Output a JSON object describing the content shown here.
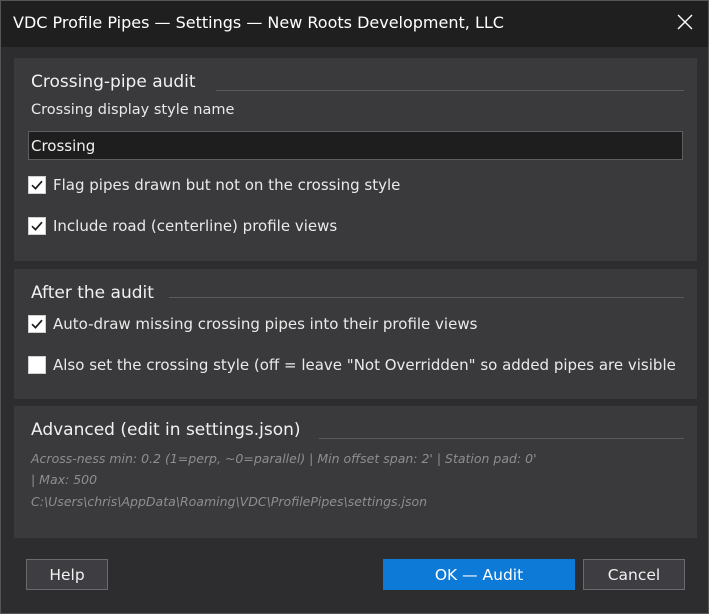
{
  "window": {
    "title": "VDC Profile Pipes — Settings — New Roots Development, LLC"
  },
  "crossing_audit": {
    "header": "Crossing-pipe audit",
    "style_name_label": "Crossing display style name",
    "style_name_value": "Crossing",
    "flag_pipes_label": "Flag pipes drawn but not on the crossing style",
    "flag_pipes_checked": true,
    "include_road_label": "Include road (centerline) profile views",
    "include_road_checked": true
  },
  "after_audit": {
    "header": "After the audit",
    "auto_draw_label": "Auto-draw missing crossing pipes into their profile views",
    "auto_draw_checked": true,
    "set_style_label": "Also set the crossing style (off = leave \"Not Overridden\" so added pipes are visible",
    "set_style_checked": false
  },
  "advanced": {
    "header": "Advanced (edit in settings.json)",
    "line1": "Across-ness min: 0.2 (1=perp, ~0=parallel)  |  Min offset span: 2'  |  Station pad: 0'",
    "line2": "|  Max: 500",
    "path": "C:\\Users\\chris\\AppData\\Roaming\\VDC\\ProfilePipes\\settings.json"
  },
  "buttons": {
    "help": "Help",
    "ok": "OK — Audit",
    "cancel": "Cancel"
  },
  "colors": {
    "accent": "#0e7ad8",
    "background": "#2d2d30",
    "panel": "#3a3a3c",
    "titlebar": "#1f1f1f"
  },
  "icons": {
    "close": "close-icon",
    "check": "checkmark-icon"
  }
}
